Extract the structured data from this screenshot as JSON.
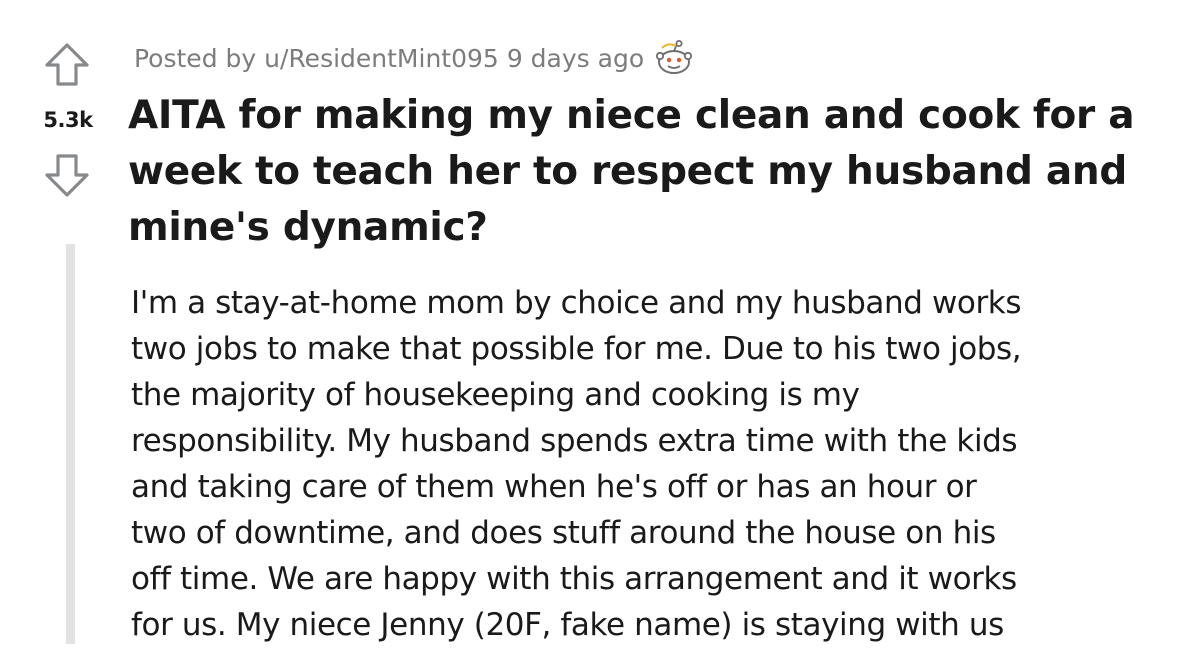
{
  "post": {
    "score": "5.3k",
    "meta": {
      "prefix": "Posted by",
      "author": "u/ResidentMint095",
      "age": "9 days ago",
      "award_icon": "wholesome-award-icon"
    },
    "title": "AITA for making my niece clean and cook for a week to teach her to respect my husband and mine's dynamic?",
    "body_lines": [
      "I'm a stay-at-home mom by choice and my husband works",
      "two jobs to make that possible for me. Due to his two jobs,",
      "the majority of housekeeping and cooking is my",
      "responsibility. My husband spends extra time with the kids",
      "and taking care of them when he's off or has an hour or",
      "two of downtime, and does stuff around the house on his",
      "off time. We are happy with this arrangement and it works",
      "for us. My niece Jenny (20F, fake name) is staying with us"
    ]
  },
  "icons": {
    "upvote": "upvote-arrow-icon",
    "downvote": "downvote-arrow-icon"
  },
  "colors": {
    "text": "#1a1a1b",
    "meta": "#7c7c7c",
    "arrow": "#878a8c",
    "thread_line": "#e2e2e2"
  }
}
